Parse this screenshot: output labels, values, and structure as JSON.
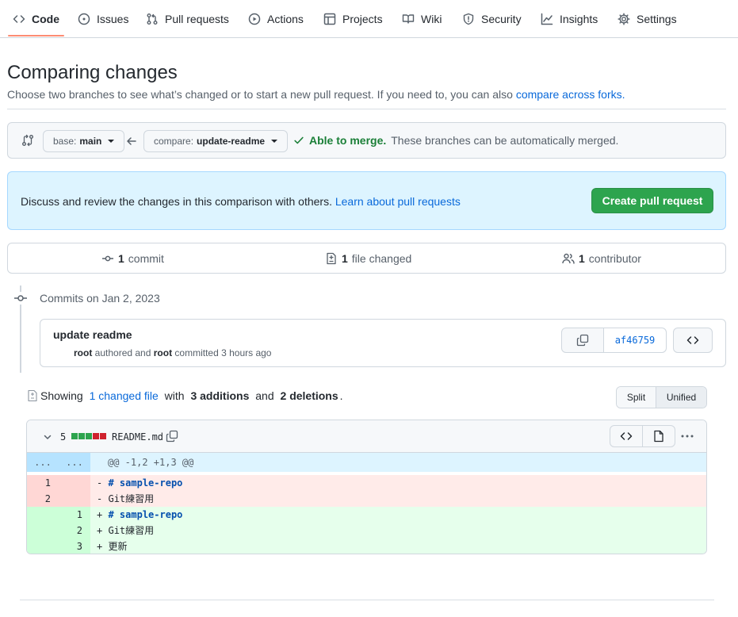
{
  "nav": {
    "tabs": [
      {
        "label": "Code",
        "icon": "code-icon"
      },
      {
        "label": "Issues",
        "icon": "issue-icon"
      },
      {
        "label": "Pull requests",
        "icon": "pull-request-icon"
      },
      {
        "label": "Actions",
        "icon": "play-icon"
      },
      {
        "label": "Projects",
        "icon": "table-icon"
      },
      {
        "label": "Wiki",
        "icon": "book-icon"
      },
      {
        "label": "Security",
        "icon": "shield-icon"
      },
      {
        "label": "Insights",
        "icon": "graph-icon"
      },
      {
        "label": "Settings",
        "icon": "gear-icon"
      }
    ],
    "active": "Code"
  },
  "page": {
    "title": "Comparing changes",
    "subtitle": "Choose two branches to see what’s changed or to start a new pull request. If you need to, you can also",
    "subtitle_link": "compare across forks."
  },
  "range": {
    "base_prefix": "base:",
    "base_branch": "main",
    "compare_prefix": "compare:",
    "compare_branch": "update-readme",
    "merge_status": "Able to merge.",
    "merge_note": "These branches can be automatically merged."
  },
  "flash": {
    "text": "Discuss and review the changes in this comparison with others.",
    "link": "Learn about pull requests",
    "button": "Create pull request"
  },
  "summary": {
    "commits_count": "1",
    "commits_label": "commit",
    "files_count": "1",
    "files_label": "file changed",
    "contributors_count": "1",
    "contributors_label": "contributor"
  },
  "timeline": {
    "heading": "Commits on Jan 2, 2023",
    "commit": {
      "title": "update readme",
      "author": "root",
      "authored_text": "authored and",
      "committer": "root",
      "committed_text": "committed 3 hours ago",
      "sha": "af46759"
    }
  },
  "diffstat": {
    "prefix": "Showing",
    "files_link": "1 changed file",
    "with": "with",
    "additions": "3 additions",
    "and": "and",
    "deletions": "2 deletions",
    "end": ".",
    "view_split": "Split",
    "view_unified": "Unified",
    "view_selected": "Unified"
  },
  "file": {
    "change_count": "5",
    "blocks": [
      "add",
      "add",
      "add",
      "del",
      "del"
    ],
    "name": "README.md",
    "hunk": {
      "left": "...",
      "right": "...",
      "header": "@@ -1,2 +1,3 @@"
    },
    "lines": [
      {
        "type": "del",
        "old": "1",
        "new": "",
        "sign": "-",
        "text": "# sample-repo"
      },
      {
        "type": "del",
        "old": "2",
        "new": "",
        "sign": "-",
        "text": "Git練習用"
      },
      {
        "type": "add",
        "old": "",
        "new": "1",
        "sign": "+",
        "text": "# sample-repo"
      },
      {
        "type": "add",
        "old": "",
        "new": "2",
        "sign": "+",
        "text": "Git練習用"
      },
      {
        "type": "add",
        "old": "",
        "new": "3",
        "sign": "+",
        "text": "更新"
      }
    ]
  },
  "colors": {
    "accent": "#0969da",
    "success": "#2da44e",
    "tab_underline": "#fd8c73",
    "add_block": "#2da44e",
    "del_block": "#cf222e"
  }
}
